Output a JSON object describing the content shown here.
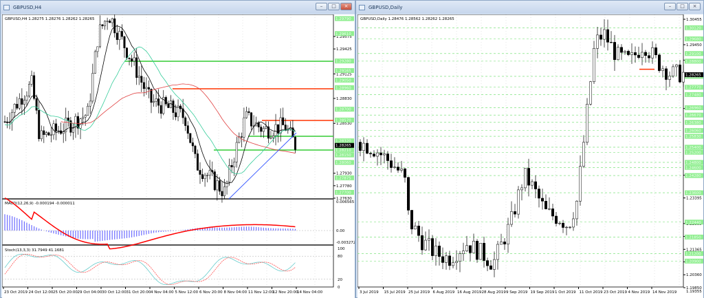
{
  "left": {
    "title": "GBPUSD,H4",
    "info": "GBPUSD,H4  1.28275 1.28276 1.28262 1.28265",
    "current": "1.28265",
    "price_labels": [
      "1.29575",
      "1.29425",
      "1.29125",
      "1.28830",
      "1.28530",
      "1.27930",
      "1.27780",
      "1.27630"
    ],
    "level_labels": [
      "1.29790",
      "1.29610",
      "1.29280",
      "1.29165",
      "1.29050",
      "1.28960",
      "1.28700",
      "1.28570",
      "1.28320",
      "1.28210",
      "1.28150",
      "1.28060",
      "1.27875",
      "1.27700"
    ],
    "time_labels": [
      "23 Oct 2019",
      "24 Oct 12:00",
      "25 Oct 20:00",
      "29 Oct 04:00",
      "30 Oct 12:00",
      "31 Oct 20:00",
      "4 Nov 04:00",
      "5 Nov 12:00",
      "6 Nov 20:00",
      "8 Nov 04:00",
      "11 Nov 12:00",
      "12 Nov 20:00",
      "14 Nov 04:00"
    ],
    "macd": {
      "label": "MACD(12,26,9) -0.000194 -0.000011",
      "top": "0.006565",
      "zero": "0.00",
      "bottom": "-0.003272"
    },
    "stoch": {
      "label": "Stoch(13,3,3) 31.7949 41.1681",
      "levels": [
        "100",
        "80",
        "20",
        "0"
      ]
    },
    "price_path": [
      [
        0,
        1.2855
      ],
      [
        8,
        1.2885
      ],
      [
        13,
        1.29
      ],
      [
        17,
        1.2835
      ],
      [
        30,
        1.285
      ],
      [
        40,
        1.2865
      ],
      [
        45,
        1.296
      ],
      [
        50,
        1.2985
      ],
      [
        55,
        1.296
      ],
      [
        62,
        1.2925
      ],
      [
        70,
        1.288
      ],
      [
        80,
        1.287
      ],
      [
        87,
        1.286
      ],
      [
        92,
        1.2805
      ],
      [
        100,
        1.2785
      ],
      [
        106,
        1.277
      ],
      [
        110,
        1.281
      ],
      [
        116,
        1.286
      ],
      [
        125,
        1.2845
      ],
      [
        135,
        1.285
      ],
      [
        140,
        1.2827
      ]
    ]
  },
  "right": {
    "title": "GBPUSD,Daily",
    "info": "GBPUSD,Daily  1.28476 1.28562 1.28262 1.28265",
    "current": "1.28265",
    "price_labels": [
      "1.30455",
      "1.29450",
      "1.28840",
      "1.26930",
      "1.24295",
      "1.23395",
      "1.22385",
      "1.21875",
      "1.21365",
      "1.20870",
      "1.20360",
      "1.19850"
    ],
    "level_labels": [
      "1.30120",
      "1.29680",
      "1.29100",
      "1.28800",
      "1.28200",
      "1.27770",
      "1.27480",
      "1.26960",
      "1.26670",
      "1.26380",
      "1.26060",
      "1.25830",
      "1.25400",
      "1.25200",
      "1.24800",
      "1.24600",
      "1.24280",
      "1.23600",
      "1.22440",
      "1.21850",
      "1.21200",
      "1.20900"
    ],
    "bottom_label": "1.19355",
    "time_labels": [
      "3 Jul 2019",
      "15 Jul 2019",
      "25 Jul 2019",
      "6 Aug 2019",
      "16 Aug 2019",
      "28 Aug 2019",
      "9 Sep 2019",
      "19 Sep 2019",
      "1 Oct 2019",
      "11 Oct 2019",
      "23 Oct 2019",
      "4 Nov 2019",
      "14 Nov 2019"
    ],
    "price_path": [
      [
        0,
        1.256
      ],
      [
        7,
        1.253
      ],
      [
        15,
        1.247
      ],
      [
        20,
        1.242
      ],
      [
        22,
        1.225
      ],
      [
        28,
        1.217
      ],
      [
        34,
        1.212
      ],
      [
        40,
        1.21
      ],
      [
        48,
        1.216
      ],
      [
        55,
        1.212
      ],
      [
        60,
        1.208
      ],
      [
        68,
        1.224
      ],
      [
        74,
        1.243
      ],
      [
        78,
        1.238
      ],
      [
        84,
        1.228
      ],
      [
        90,
        1.226
      ],
      [
        94,
        1.223
      ],
      [
        98,
        1.233
      ],
      [
        102,
        1.264
      ],
      [
        106,
        1.295
      ],
      [
        110,
        1.299
      ],
      [
        116,
        1.29
      ],
      [
        122,
        1.288
      ],
      [
        128,
        1.295
      ],
      [
        134,
        1.288
      ],
      [
        140,
        1.283
      ],
      [
        146,
        1.283
      ]
    ]
  },
  "colors": {
    "up": "#ffffff",
    "down": "#000000",
    "green_level": "#33cc33",
    "red_level": "#ff3300",
    "label_bg": "#90ee90",
    "macd_hist": "#6b6bff",
    "signal": "#ff0000",
    "stoch_main": "#66cccc",
    "stoch_signal": "#ff5555"
  }
}
